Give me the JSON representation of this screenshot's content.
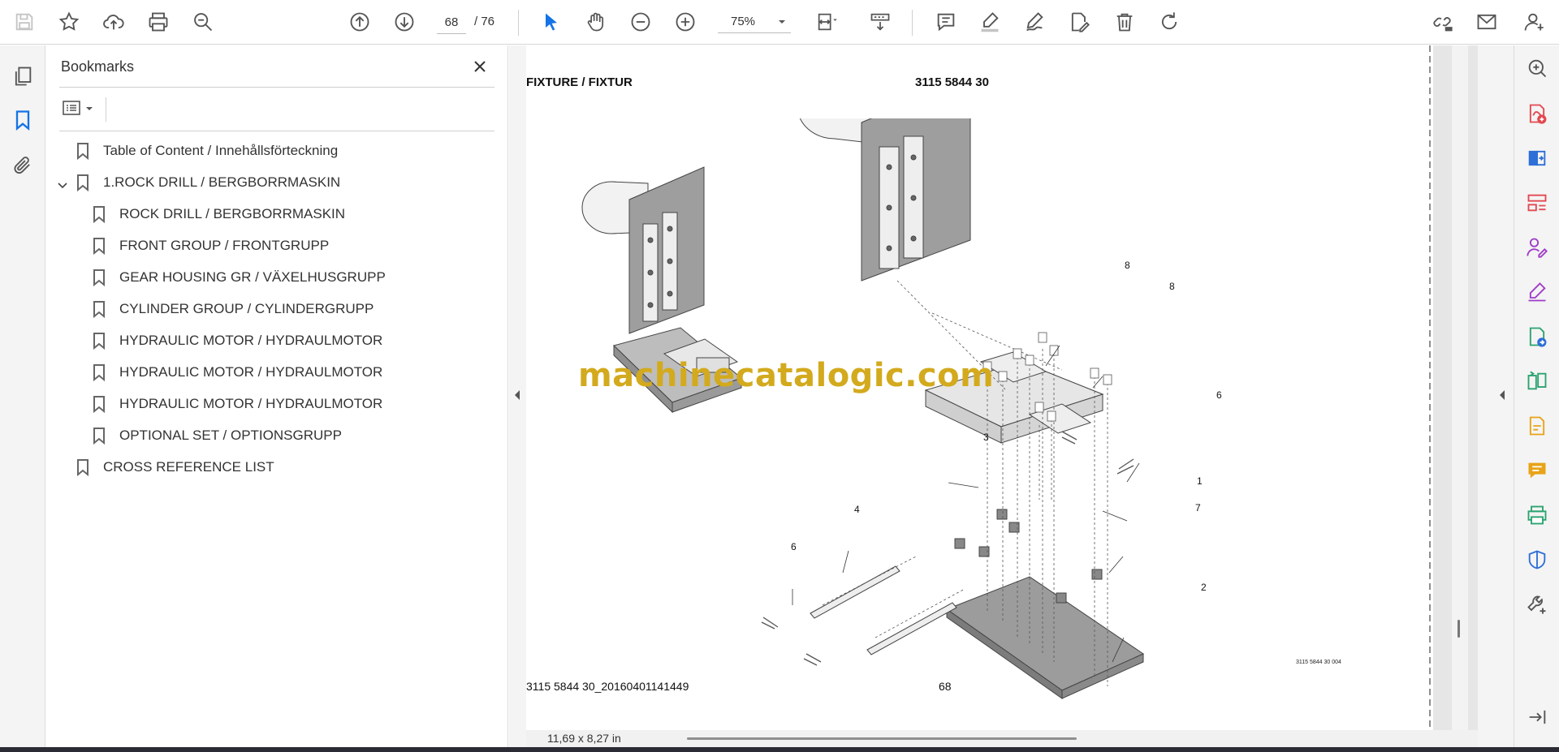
{
  "toolbar": {
    "current_page": "68",
    "total_pages": "/ 76",
    "zoom": "75%",
    "icons": [
      "save-icon",
      "star-icon",
      "upload-icon",
      "print-icon",
      "zoom-search-icon",
      "page-up-icon",
      "page-down-icon",
      "cursor-icon",
      "hand-icon",
      "zoom-out-icon",
      "zoom-in-icon",
      "fit-page-icon",
      "scroll-mode-icon",
      "comment-icon",
      "highlight-icon",
      "draw-icon",
      "edit-icon",
      "delete-icon",
      "rotate-icon",
      "share-link-icon",
      "email-icon",
      "account-icon"
    ]
  },
  "left_rail": {
    "icons": [
      "pages-icon",
      "bookmark-icon",
      "attachment-icon"
    ]
  },
  "bookmarks": {
    "title": "Bookmarks",
    "items": [
      {
        "label": "Table of Content / Innehållsförteckning",
        "level": 0
      },
      {
        "label": "1.ROCK DRILL / BERGBORRMASKIN",
        "level": 0,
        "expanded": true
      },
      {
        "label": "ROCK DRILL / BERGBORRMASKIN",
        "level": 1
      },
      {
        "label": "FRONT GROUP / FRONTGRUPP",
        "level": 1
      },
      {
        "label": "GEAR HOUSING GR / VÄXELHUSGRUPP",
        "level": 1
      },
      {
        "label": "CYLINDER GROUP / CYLINDERGRUPP",
        "level": 1
      },
      {
        "label": "HYDRAULIC MOTOR / HYDRAULMOTOR",
        "level": 1
      },
      {
        "label": "HYDRAULIC MOTOR / HYDRAULMOTOR",
        "level": 1
      },
      {
        "label": "HYDRAULIC MOTOR / HYDRAULMOTOR",
        "level": 1
      },
      {
        "label": "OPTIONAL SET / OPTIONSGRUPP",
        "level": 1
      },
      {
        "label": "CROSS REFERENCE LIST",
        "level": 0
      }
    ]
  },
  "page": {
    "header_left": "FIXTURE / FIXTUR",
    "header_right": "3115 5844 30",
    "watermark": "machinecatalogic.com",
    "footer_left": "3115 5844 30_20160401141449",
    "footer_page": "68",
    "drawing_ref": "3115 5844 30 004",
    "callouts": [
      "8",
      "8",
      "6",
      "3",
      "1",
      "4",
      "6",
      "7",
      "2"
    ]
  },
  "status": {
    "page_size": "11,69 x 8,27 in"
  },
  "right_rail": {
    "icons": [
      "zoom-tool-icon",
      "export-pdf-icon",
      "create-pdf-icon",
      "organize-pages-icon",
      "request-signature-icon",
      "fill-sign-icon",
      "convert-icon",
      "compare-icon",
      "scan-icon",
      "comment-tool-icon",
      "print-production-icon",
      "protect-icon",
      "more-tools-icon",
      "collapse-panel-icon"
    ]
  },
  "colors": {
    "accent": "#1473e6",
    "watermark": "#d3aa1d",
    "red_tool": "#e34850",
    "purple_tool": "#a03cc8"
  }
}
